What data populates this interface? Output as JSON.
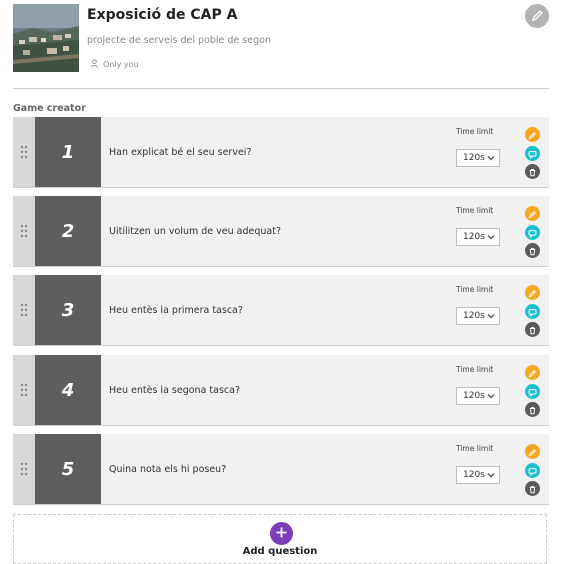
{
  "header": {
    "title": "Exposició de CAP A",
    "subtitle": "projecte de serveis del poble de segon",
    "visibility": "Only you"
  },
  "section_label": "Game creator",
  "questions": [
    {
      "number": "1",
      "text": "Han explicat bé el seu servei?",
      "time_limit_label": "Time limit",
      "time_limit_value": "120s"
    },
    {
      "number": "2",
      "text": "Uitilitzen un volum de veu adequat?",
      "time_limit_label": "Time limit",
      "time_limit_value": "120s"
    },
    {
      "number": "3",
      "text": "Heu entès la primera tasca?",
      "time_limit_label": "Time limit",
      "time_limit_value": "120s"
    },
    {
      "number": "4",
      "text": "Heu entès la segona tasca?",
      "time_limit_label": "Time limit",
      "time_limit_value": "120s"
    },
    {
      "number": "5",
      "text": "Quina nota els hi poseu?",
      "time_limit_label": "Time limit",
      "time_limit_value": "120s"
    }
  ],
  "add_question": {
    "label": "Add question"
  },
  "icons": {
    "page_edit": "pencil-icon",
    "visibility": "user-icon",
    "drag": "drag-handle-icon",
    "edit": "pencil-icon",
    "comment": "comment-icon",
    "delete": "trash-icon",
    "add": "plus-icon",
    "dropdown": "chevron-down-icon"
  },
  "colors": {
    "edit": "#f5a623",
    "comment": "#1cbfcf",
    "delete": "#5b5b5b",
    "number_bg": "#5e5e5e",
    "add": "#7b3fb8"
  }
}
